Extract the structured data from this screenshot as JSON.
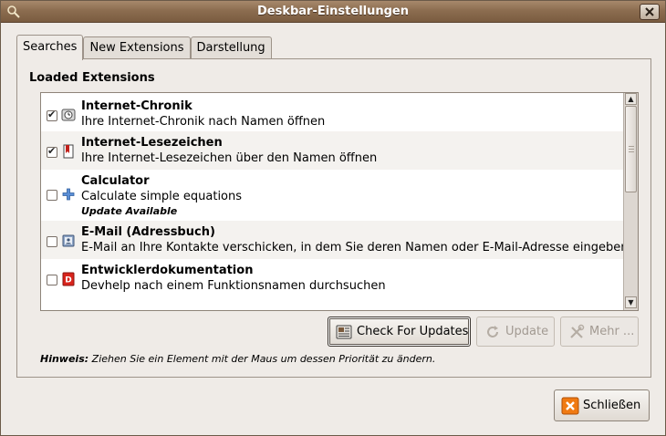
{
  "window": {
    "title": "Deskbar-Einstellungen"
  },
  "tabs": [
    {
      "label": "Searches",
      "active": true
    },
    {
      "label": "New Extensions",
      "active": false
    },
    {
      "label": "Darstellung",
      "active": false
    }
  ],
  "section": {
    "title": "Loaded Extensions"
  },
  "extensions": [
    {
      "name": "Internet-Chronik",
      "description": "Ihre Internet-Chronik nach Namen öffnen",
      "checked": true,
      "icon": "history-icon"
    },
    {
      "name": "Internet-Lesezeichen",
      "description": "Ihre Internet-Lesezeichen über den Namen öffnen",
      "checked": true,
      "icon": "bookmark-icon"
    },
    {
      "name": "Calculator",
      "description": "Calculate simple equations",
      "update": "Update Available",
      "checked": false,
      "icon": "plus-icon"
    },
    {
      "name": "E-Mail (Adressbuch)",
      "description": "E-Mail an Ihre Kontakte verschicken, in dem Sie deren Namen oder E-Mail-Adresse eingeben",
      "checked": false,
      "icon": "addressbook-icon"
    },
    {
      "name": "Entwicklerdokumentation",
      "description": "Devhelp nach einem Funktionsnamen durchsuchen",
      "checked": false,
      "icon": "devhelp-icon"
    }
  ],
  "buttons": {
    "check_updates": "Check For Updates",
    "update": "Update",
    "more": "Mehr ...",
    "close": "Schließen"
  },
  "hint": {
    "label": "Hinweis:",
    "text": " Ziehen Sie ein Element mit der Maus um dessen Priorität zu ändern."
  }
}
